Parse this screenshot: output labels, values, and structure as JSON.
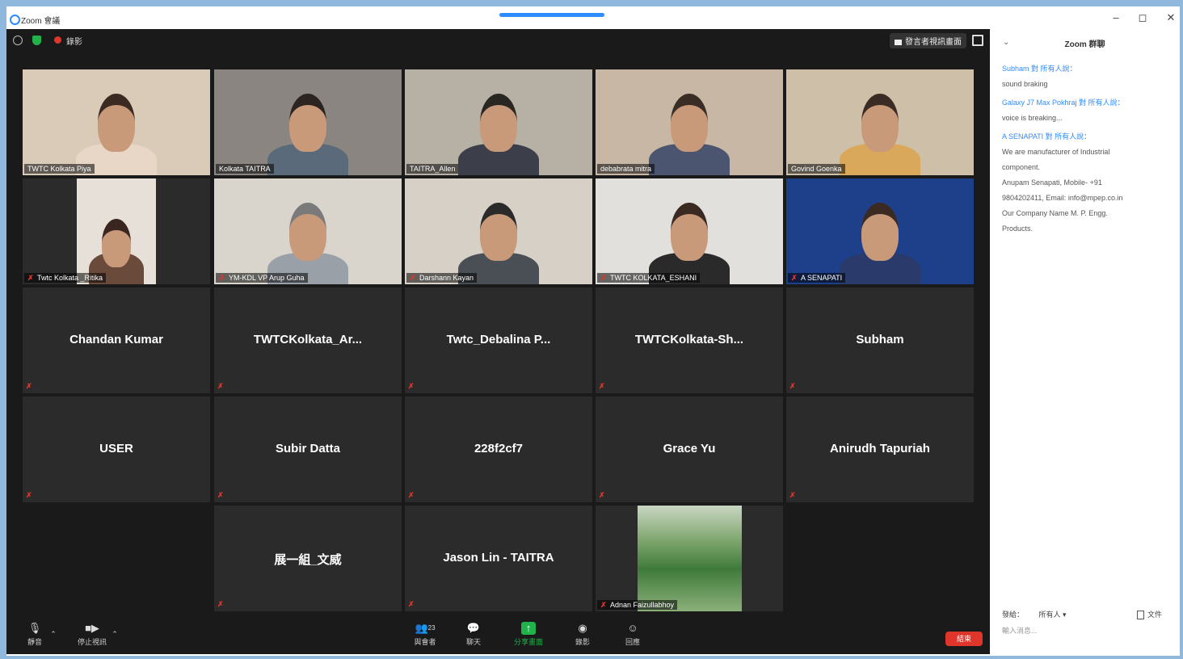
{
  "window": {
    "title": "Zoom 會議",
    "minimize": "–",
    "restore": "◻",
    "close": "✕"
  },
  "topbar": {
    "recording_label": "錄影",
    "view_button_label": "發言者視訊畫面"
  },
  "tiles": [
    {
      "name": "TWTC Kolkata Piya",
      "type": "video",
      "active": true
    },
    {
      "name": "Kolkata TAITRA",
      "type": "video"
    },
    {
      "name": "TAITRA_Allen",
      "type": "video"
    },
    {
      "name": "debabrata mitra",
      "type": "video"
    },
    {
      "name": "Govind Goenka",
      "type": "video"
    },
    {
      "name": "Twtc Kolkata _Ritika",
      "type": "video",
      "muted": true
    },
    {
      "name": "YM-KDL VP Arup Guha",
      "type": "video",
      "muted": true
    },
    {
      "name": "Darshann Kayan",
      "type": "video",
      "muted": true
    },
    {
      "name": "TWTC KOLKATA_ESHANI",
      "type": "video",
      "muted": true
    },
    {
      "name": "A SENAPATI",
      "type": "video",
      "muted": true
    },
    {
      "name": "Chandan Kumar",
      "type": "name"
    },
    {
      "name": "TWTCKolkata_Ar...",
      "type": "name"
    },
    {
      "name": "Twtc_Debalina  P...",
      "type": "name"
    },
    {
      "name": "TWTCKolkata-Sh...",
      "type": "name"
    },
    {
      "name": "Subham",
      "type": "name"
    },
    {
      "name": "USER",
      "type": "name"
    },
    {
      "name": "Subir Datta",
      "type": "name"
    },
    {
      "name": "228f2cf7",
      "type": "name"
    },
    {
      "name": "Grace Yu",
      "type": "name"
    },
    {
      "name": "Anirudh Tapuriah",
      "type": "name"
    },
    {
      "name": "展一組_文威",
      "type": "name"
    },
    {
      "name": "Jason Lin - TAITRA",
      "type": "name"
    },
    {
      "name": "Adnan Faizullabhoy",
      "type": "photo",
      "muted": true
    }
  ],
  "toolbar": {
    "mute_label": "靜音",
    "video_label": "停止視訊",
    "participants_label": "與會者",
    "participants_count": "23",
    "chat_label": "聊天",
    "share_label": "分享畫面",
    "record_label": "錄影",
    "reactions_label": "回應",
    "end_label": "結束"
  },
  "chat": {
    "title": "Zoom 群聊",
    "messages": [
      {
        "from": "Subham 對 所有人說：",
        "lines": [
          "sound braking"
        ]
      },
      {
        "from": "Galaxy J7 Max Pokhraj 對 所有人說：",
        "lines": [
          "voice is breaking..."
        ]
      },
      {
        "from": "A SENAPATI 對 所有人說：",
        "lines": [
          "We are manufacturer of Industrial",
          "component.",
          "Anupam Senapati, Mobile- +91",
          "9804202411, Email: info@mpep.co.in",
          "Our Company Name M. P. Engg.",
          "Products."
        ]
      }
    ],
    "to_label": "發給：",
    "to_value": "所有人 ▾",
    "file_label": "文件",
    "input_placeholder": "輸入消息..."
  },
  "colors": {
    "accent": "#2d8cff",
    "active_speaker": "#f2e34a",
    "muted": "#e0352b",
    "share": "#21b24b"
  }
}
